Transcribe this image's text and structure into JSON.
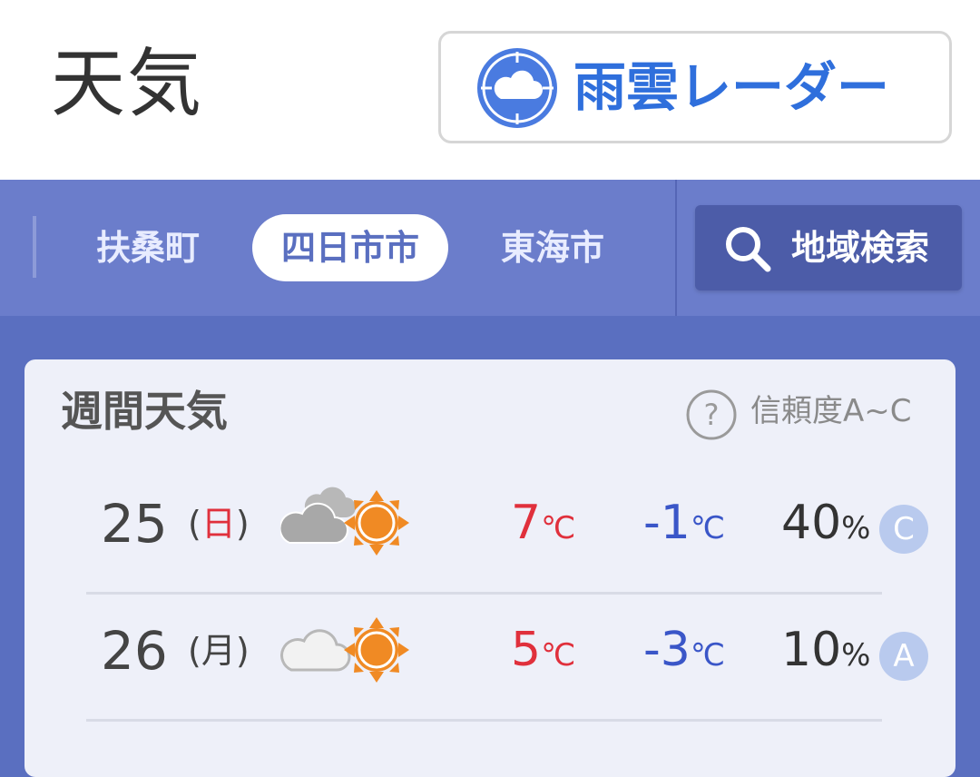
{
  "header": {
    "title": "天気",
    "radar_button": {
      "label": "雨雲レーダー",
      "icon": "radar-cloud-icon"
    }
  },
  "location_bar": {
    "tabs": [
      {
        "label": "扶桑町",
        "active": false
      },
      {
        "label": "四日市市",
        "active": true
      },
      {
        "label": "東海市",
        "active": false
      }
    ],
    "search_button": {
      "label": "地域検索",
      "icon": "search-icon"
    }
  },
  "weekly": {
    "title": "週間天気",
    "reliability_label": "信頼度A~C",
    "rows": [
      {
        "day": "25",
        "weekday": "日",
        "icon": "cloudy-then-sunny-icon",
        "max": "7",
        "min": "-1",
        "pop": "40",
        "grade": "C"
      },
      {
        "day": "26",
        "weekday": "月",
        "icon": "partly-cloudy-sunny-icon",
        "max": "5",
        "min": "-3",
        "pop": "10",
        "grade": "A"
      }
    ],
    "temp_unit": "℃",
    "pop_unit": "%"
  },
  "colors": {
    "accent": "#2f6fdc",
    "location_bar": "#6b7dcb",
    "max_temp": "#e0303c",
    "min_temp": "#3a56c8",
    "sunday": "#e0303c"
  }
}
